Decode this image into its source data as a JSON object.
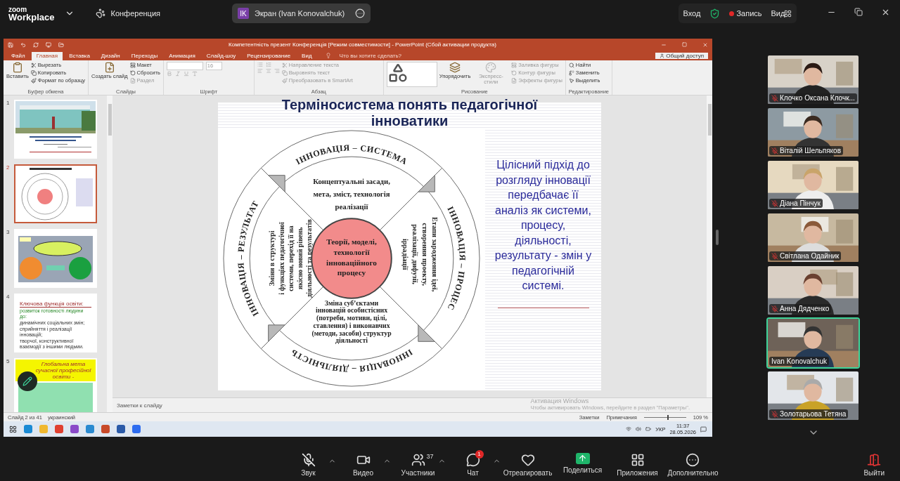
{
  "app": {
    "logo_top": "zoom",
    "logo_bottom": "Workplace",
    "meeting_label": "Конференция"
  },
  "share_pill": {
    "initials": "IK",
    "label": "Экран (Ivan Konovalchuk)"
  },
  "top_right": {
    "signin": "Вход",
    "record": "Запись",
    "view": "Вид"
  },
  "powerpoint": {
    "title": "Компетентність презент Конференція [Режим совместимости] - PowerPoint (Сбой активации продукта)",
    "tabs": [
      {
        "label": "Файл",
        "selected": false
      },
      {
        "label": "Главная",
        "selected": true
      },
      {
        "label": "Вставка",
        "selected": false
      },
      {
        "label": "Дизайн",
        "selected": false
      },
      {
        "label": "Переходы",
        "selected": false
      },
      {
        "label": "Анимация",
        "selected": false
      },
      {
        "label": "Слайд-шоу",
        "selected": false
      },
      {
        "label": "Рецензирование",
        "selected": false
      },
      {
        "label": "Вид",
        "selected": false
      }
    ],
    "tell_me": "Что вы хотите сделать?",
    "share": "Общий доступ",
    "ribbon_groups": [
      {
        "label": "Буфер обмена",
        "items": [
          {
            "kind": "big",
            "label": "Вставить",
            "disabled": false
          },
          {
            "kind": "small",
            "label": "Вырезать",
            "disabled": false
          },
          {
            "kind": "small",
            "label": "Копировать",
            "disabled": false
          },
          {
            "kind": "small",
            "label": "Формат по образцу",
            "disabled": false
          }
        ]
      },
      {
        "label": "Слайды",
        "items": [
          {
            "kind": "big",
            "label": "Создать слайд",
            "disabled": false
          },
          {
            "kind": "small",
            "label": "Макет",
            "disabled": false
          },
          {
            "kind": "small",
            "label": "Сбросить",
            "disabled": false
          },
          {
            "kind": "small",
            "label": "Раздел",
            "disabled": true
          }
        ]
      },
      {
        "label": "Шрифт",
        "items": [
          {
            "kind": "font",
            "label": "16",
            "disabled": true
          }
        ]
      },
      {
        "label": "Абзац",
        "items": [
          {
            "kind": "paragraph",
            "disabled": true
          },
          {
            "kind": "small",
            "label": "Направление текста",
            "disabled": true
          },
          {
            "kind": "small",
            "label": "Выровнять текст",
            "disabled": true
          },
          {
            "kind": "small",
            "label": "Преобразовать в SmartArt",
            "disabled": true
          }
        ]
      },
      {
        "label": "Рисование",
        "items": [
          {
            "kind": "shapes",
            "disabled": false
          },
          {
            "kind": "big",
            "label": "Упорядочить",
            "disabled": false
          },
          {
            "kind": "big",
            "label": "Экспресс-стили",
            "disabled": true
          },
          {
            "kind": "small",
            "label": "Заливка фигуры",
            "disabled": true
          },
          {
            "kind": "small",
            "label": "Контур фигуры",
            "disabled": true
          },
          {
            "kind": "small",
            "label": "Эффекты фигуры",
            "disabled": true
          }
        ]
      },
      {
        "label": "Редактирование",
        "items": [
          {
            "kind": "small",
            "label": "Найти",
            "disabled": false
          },
          {
            "kind": "small",
            "label": "Заменить",
            "disabled": false
          },
          {
            "kind": "small",
            "label": "Выделить",
            "disabled": false
          }
        ]
      }
    ],
    "thumbnails": [
      {
        "number": "1",
        "selected": false
      },
      {
        "number": "2",
        "selected": true,
        "kind": "diagram"
      },
      {
        "number": "3",
        "selected": false,
        "kind": "ovals"
      },
      {
        "number": "4",
        "selected": false,
        "kind": "list",
        "title": "Ключова функція освіти:",
        "lines": [
          "розвиток готовності людини до:",
          "динамічних соціальних змін;",
          "сприйняття і реалізації інновацій;",
          "творчої, конструктивної взаємодії з іншими людьми."
        ]
      },
      {
        "number": "5",
        "selected": false,
        "kind": "banner",
        "title": "Глобальна мета сучасної професійної освіти -"
      }
    ],
    "slide": {
      "title": "Терміносистема понять педагогічної інноватики",
      "ring_labels": [
        "ІННОВАЦІЯ – СИСТЕМА",
        "ІННОВАЦІЯ – ПРОЦЕС",
        "ІННОВАЦІЯ – ДІЯЛЬНІСТЬ",
        "ІННОВАЦІЯ – РЕЗУЛЬТАТ"
      ],
      "top_text": [
        "Концептуальні засади,",
        "мета, зміст, технологія",
        "реалізації"
      ],
      "right_text": [
        "Етапи зародження ідеї,",
        "створення проекту,",
        "реалізації, дифузії,",
        "іррадіації"
      ],
      "bottom_text": [
        "Зміна суб’єктами",
        "інновацій особистісних",
        "(потреби, мотиви, цілі,",
        "ставлення) і виконавчих",
        "(методи, засоби) структур",
        "діяльності"
      ],
      "left_text": [
        "Зміни в структурі",
        "і функціях педагогічної",
        "системи, перехід її на",
        "якісно новий рівень",
        "діяльності та результатів"
      ],
      "center_text": [
        "Теорії, моделі,",
        "технології",
        "інноваційного",
        "процесу"
      ],
      "side_text": "Цілісний підхід до розгляду інновації передбачає її аналіз як системи, процесу, діяльності, результату - змін у педагогічній системі."
    },
    "notes_placeholder": "Заметки к слайду",
    "activation": {
      "title": "Активация Windows",
      "text": "Чтобы активировать Windows, перейдите в раздел \"Параметры\"."
    },
    "status": {
      "slide": "Слайд 2 из 41",
      "language": "украинский",
      "notes": "Заметки",
      "comments": "Примечания",
      "zoom": "109 %",
      "level": 0.55
    },
    "taskbar": {
      "keyboard": "УКР",
      "time": "11:37",
      "date": "28.05.2026"
    }
  },
  "participants": [
    {
      "name": "Клочко Оксана Клочк...",
      "muted": true,
      "speaking": false
    },
    {
      "name": "Віталій Шельпяков",
      "muted": true,
      "speaking": false
    },
    {
      "name": "Діана Пінчук",
      "muted": true,
      "speaking": false
    },
    {
      "name": "Світлана Одайник",
      "muted": true,
      "speaking": false
    },
    {
      "name": "Анна Дядченко",
      "muted": true,
      "speaking": false
    },
    {
      "name": "Ivan Konovalchuk",
      "muted": false,
      "speaking": true
    },
    {
      "name": "Золотарьова Тетяна",
      "muted": true,
      "speaking": false
    }
  ],
  "toolbar": [
    {
      "kind": "audio",
      "label": "Звук",
      "menu": true
    },
    {
      "kind": "video",
      "label": "Видео",
      "menu": true
    },
    {
      "kind": "participants",
      "label": "Участники",
      "menu": true,
      "count": "37"
    },
    {
      "kind": "chat",
      "label": "Чат",
      "menu": true,
      "badge": "1"
    },
    {
      "kind": "react",
      "label": "Отреагировать",
      "menu": false
    },
    {
      "kind": "share",
      "label": "Поделиться",
      "menu": false
    },
    {
      "kind": "apps",
      "label": "Приложения",
      "menu": false
    },
    {
      "kind": "more",
      "label": "Дополнительно",
      "menu": false
    }
  ],
  "leave": {
    "label": "Выйти"
  }
}
